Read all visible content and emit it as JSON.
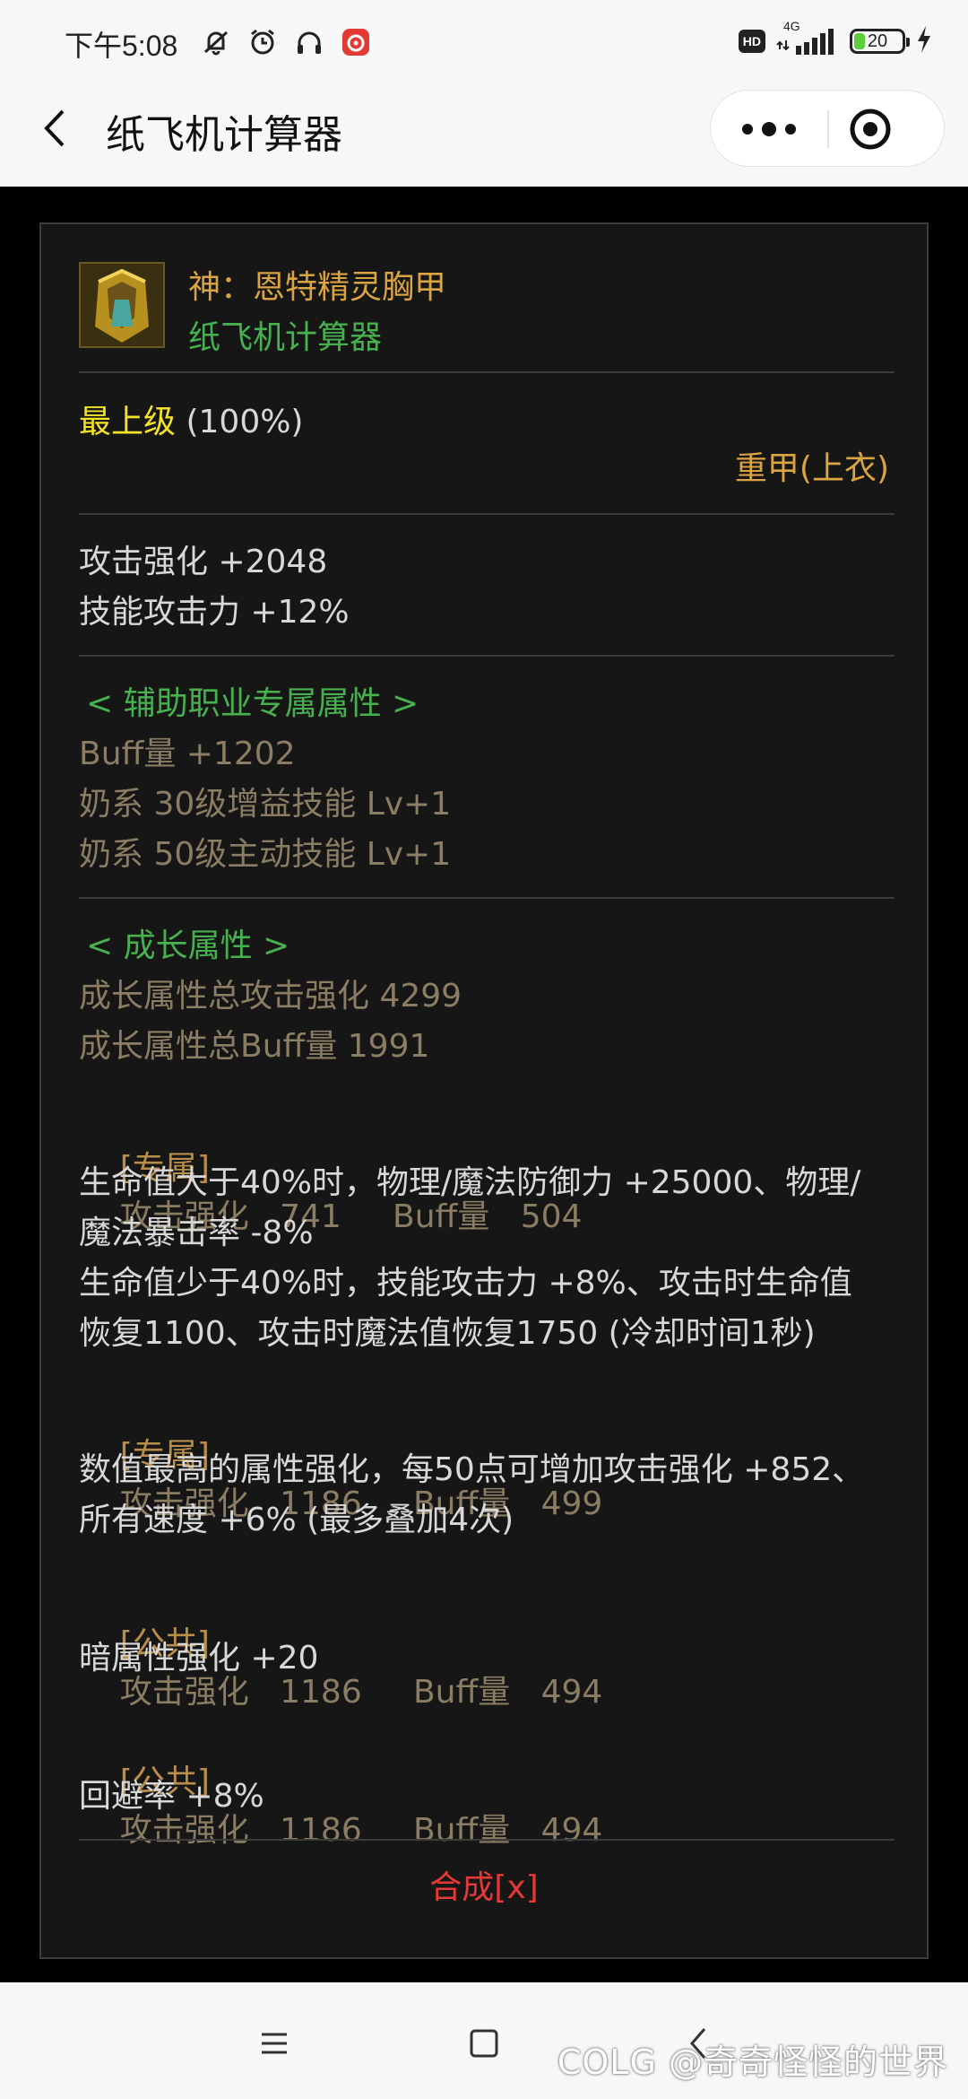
{
  "status_bar": {
    "time": "下午5:08",
    "network": "4G",
    "hd_badge": "HD",
    "battery_level": "20"
  },
  "nav": {
    "title": "纸飞机计算器"
  },
  "item": {
    "name": "神：恩特精灵胸甲",
    "subtitle": "纸飞机计算器",
    "grade_label": "最上级",
    "grade_pct": "(100%)",
    "type": "重甲(上衣)",
    "base_stats": [
      "攻击强化 +2048",
      "技能攻击力 +12%"
    ],
    "support_header": "< 辅助职业专属属性 >",
    "support_stats": [
      "Buff量 +1202",
      "奶系 30级增益技能 Lv+1",
      "奶系 50级主动技能 Lv+1"
    ],
    "growth_header": "< 成长属性 >",
    "growth_totals": [
      "成长属性总攻击强化 4299",
      "成长属性总Buff量 1991"
    ],
    "growth_options": [
      {
        "tag": "[专属]",
        "stats": "攻击强化   741     Buff量   504",
        "desc": [
          "生命值大于40%时，物理/魔法防御力 +25000、物理/",
          "魔法暴击率 -8%",
          "生命值少于40%时，技能攻击力 +8%、攻击时生命值",
          "恢复1100、攻击时魔法值恢复1750 (冷却时间1秒)"
        ]
      },
      {
        "tag": "[专属]",
        "stats": "攻击强化   1186     Buff量   499",
        "desc": [
          "数值最高的属性强化，每50点可增加攻击强化 +852、",
          "所有速度 +6% (最多叠加4次)"
        ]
      },
      {
        "tag": "[公共]",
        "stats": "攻击强化   1186     Buff量   494",
        "desc": [
          "暗属性强化 +20"
        ]
      },
      {
        "tag": "[公共]",
        "stats": "攻击强化   1186     Buff量   494",
        "desc": [
          "回避率 +8%"
        ]
      }
    ],
    "synth_button": "合成[x]"
  },
  "watermark": "COLG @奇奇怪怪的世界",
  "colors": {
    "gold": "#d9a441",
    "green": "#47b04f",
    "yellow": "#f3e12a",
    "muted": "#8a7d63",
    "red": "#e53935",
    "card_bg": "#161616"
  }
}
